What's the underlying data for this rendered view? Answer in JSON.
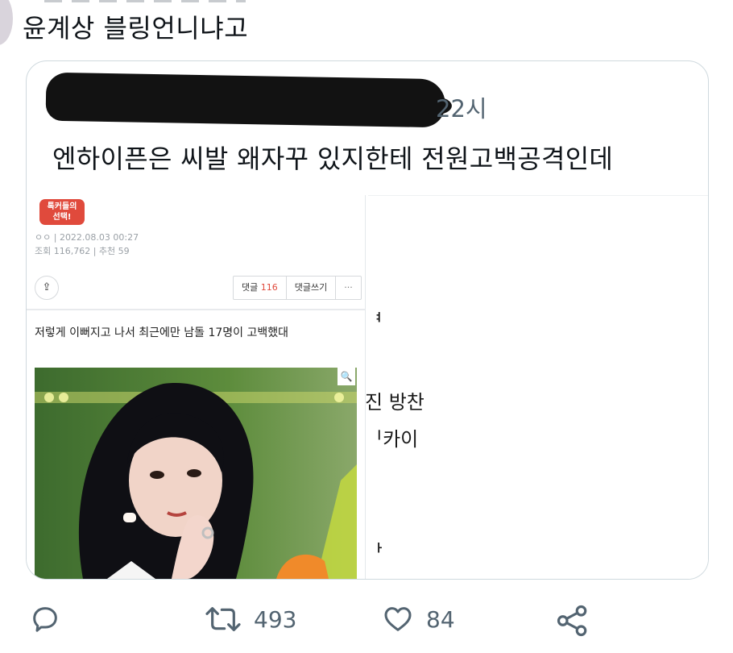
{
  "tweet": {
    "text": "윤계상 블링언니냐고"
  },
  "quote": {
    "time": "22시",
    "text": "엔하이픈은 씨발 왜자꾸 있지한테 전원고백공격인데"
  },
  "screenshot_left": {
    "badge": "톡커들의\n선택!",
    "date_line": "ㅇㅇ  |  2022.08.03 00:27",
    "stats_line": "조회 116,762  |  추천 59",
    "comment_label": "댓글",
    "comment_count": "116",
    "write_comment_label": "댓글쓰기",
    "more_label": "···",
    "share_label": "⇪",
    "post_title": "저렇게 이뻐지고 나서 최근에만 남돌 17명이 고백했대",
    "magnifier": "🔍"
  },
  "screenshot_right": {
    "fragments": [
      "ᅧ",
      "진 방찬",
      "ᅵ카이",
      "ᅡ"
    ]
  },
  "actions": {
    "reply_icon": "comment-icon",
    "retweet_count": "493",
    "like_count": "84",
    "share_icon": "share-icon"
  }
}
